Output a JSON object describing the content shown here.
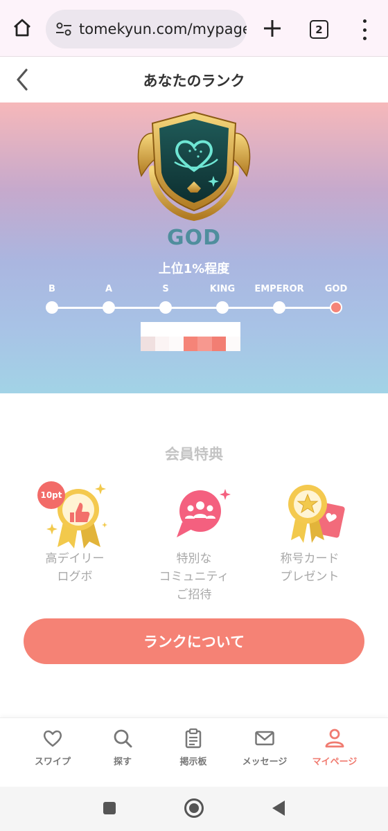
{
  "browser": {
    "url": "tomekyun.com/mypage/",
    "tab_count": "2",
    "icons": [
      "home-icon",
      "site-settings-icon",
      "plus-icon",
      "tab-count-icon",
      "more-vert-icon"
    ]
  },
  "header": {
    "title": "あなたのランク",
    "back_icon": "chevron-left-icon"
  },
  "rank": {
    "name": "GOD",
    "subtitle": "上位1%程度",
    "emblem_icon": "winged-shield-heart-emblem",
    "tiers": [
      "B",
      "A",
      "S",
      "KING",
      "EMPEROR",
      "GOD"
    ],
    "current_tier_index": 5,
    "progress_segments": [
      {
        "color": "#f0e0e0"
      },
      {
        "color": "#fbf4f4"
      },
      {
        "color": "#fdfafa"
      },
      {
        "color": "#f58478"
      },
      {
        "color": "#f7988f"
      },
      {
        "color": "#f27e73"
      },
      {
        "color": "#fdfafa"
      }
    ]
  },
  "benefits": {
    "title": "会員特典",
    "items": [
      {
        "label": "高デイリー\nログボ",
        "icon": "thumbs-up-medal-icon",
        "badge": "10pt"
      },
      {
        "label": "特別な\nコミュニティ\nご招待",
        "icon": "community-chat-icon"
      },
      {
        "label": "称号カード\nプレゼント",
        "icon": "star-medal-card-icon"
      }
    ]
  },
  "cta": {
    "label": "ランクについて"
  },
  "bottom_nav": [
    {
      "label": "スワイプ",
      "icon": "heart-outline-icon",
      "active": false
    },
    {
      "label": "探す",
      "icon": "search-icon",
      "active": false
    },
    {
      "label": "掲示板",
      "icon": "clipboard-icon",
      "active": false
    },
    {
      "label": "メッセージ",
      "icon": "mail-icon",
      "active": false
    },
    {
      "label": "マイページ",
      "icon": "person-icon",
      "active": true
    }
  ],
  "colors": {
    "accent": "#f58275",
    "rank_name": "#4f8e9d",
    "nav_active": "#f07b70"
  }
}
